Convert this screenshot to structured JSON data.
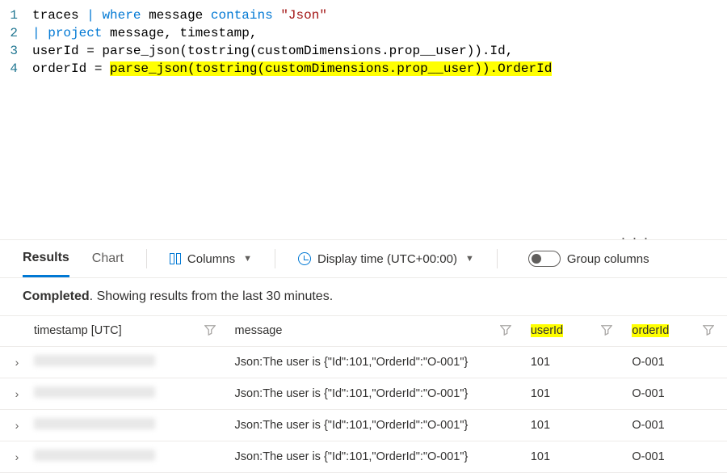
{
  "editor": {
    "lines": [
      {
        "num": "1",
        "tokens": [
          {
            "t": "traces",
            "c": "tok-plain"
          },
          {
            "t": " ",
            "c": ""
          },
          {
            "t": "|",
            "c": "tok-op"
          },
          {
            "t": " ",
            "c": ""
          },
          {
            "t": "where",
            "c": "tok-kw"
          },
          {
            "t": " ",
            "c": ""
          },
          {
            "t": "message",
            "c": "tok-plain"
          },
          {
            "t": " ",
            "c": ""
          },
          {
            "t": "contains",
            "c": "tok-kw"
          },
          {
            "t": " ",
            "c": ""
          },
          {
            "t": "\"Json\"",
            "c": "tok-str"
          }
        ]
      },
      {
        "num": "2",
        "tokens": [
          {
            "t": "|",
            "c": "tok-op"
          },
          {
            "t": " ",
            "c": ""
          },
          {
            "t": "project",
            "c": "tok-kw"
          },
          {
            "t": " ",
            "c": ""
          },
          {
            "t": "message, timestamp,",
            "c": "tok-plain"
          }
        ]
      },
      {
        "num": "3",
        "tokens": [
          {
            "t": "userId = parse_json(tostring(customDimensions.prop__user)).Id,",
            "c": "tok-plain"
          }
        ]
      },
      {
        "num": "4",
        "tokens": [
          {
            "t": "orderId = ",
            "c": "tok-plain"
          },
          {
            "t": "parse_json(tostring(customDimensions.prop__user)).OrderId",
            "c": "tok-plain hl"
          }
        ]
      }
    ]
  },
  "toolbar": {
    "tabs": {
      "results": "Results",
      "chart": "Chart"
    },
    "columns_btn": "Columns",
    "display_time_btn": "Display time (UTC+00:00)",
    "group_columns": "Group columns",
    "ellipsis": ". . ."
  },
  "status": {
    "completed": "Completed",
    "rest": ". Showing results from the last 30 minutes."
  },
  "table": {
    "headers": {
      "timestamp": "timestamp [UTC]",
      "message": "message",
      "userId": "userId",
      "orderId": "orderId"
    },
    "rows": [
      {
        "message": "Json:The user is {\"Id\":101,\"OrderId\":\"O-001\"}",
        "userId": "101",
        "orderId": "O-001"
      },
      {
        "message": "Json:The user is {\"Id\":101,\"OrderId\":\"O-001\"}",
        "userId": "101",
        "orderId": "O-001"
      },
      {
        "message": "Json:The user is {\"Id\":101,\"OrderId\":\"O-001\"}",
        "userId": "101",
        "orderId": "O-001"
      },
      {
        "message": "Json:The user is {\"Id\":101,\"OrderId\":\"O-001\"}",
        "userId": "101",
        "orderId": "O-001"
      }
    ]
  }
}
